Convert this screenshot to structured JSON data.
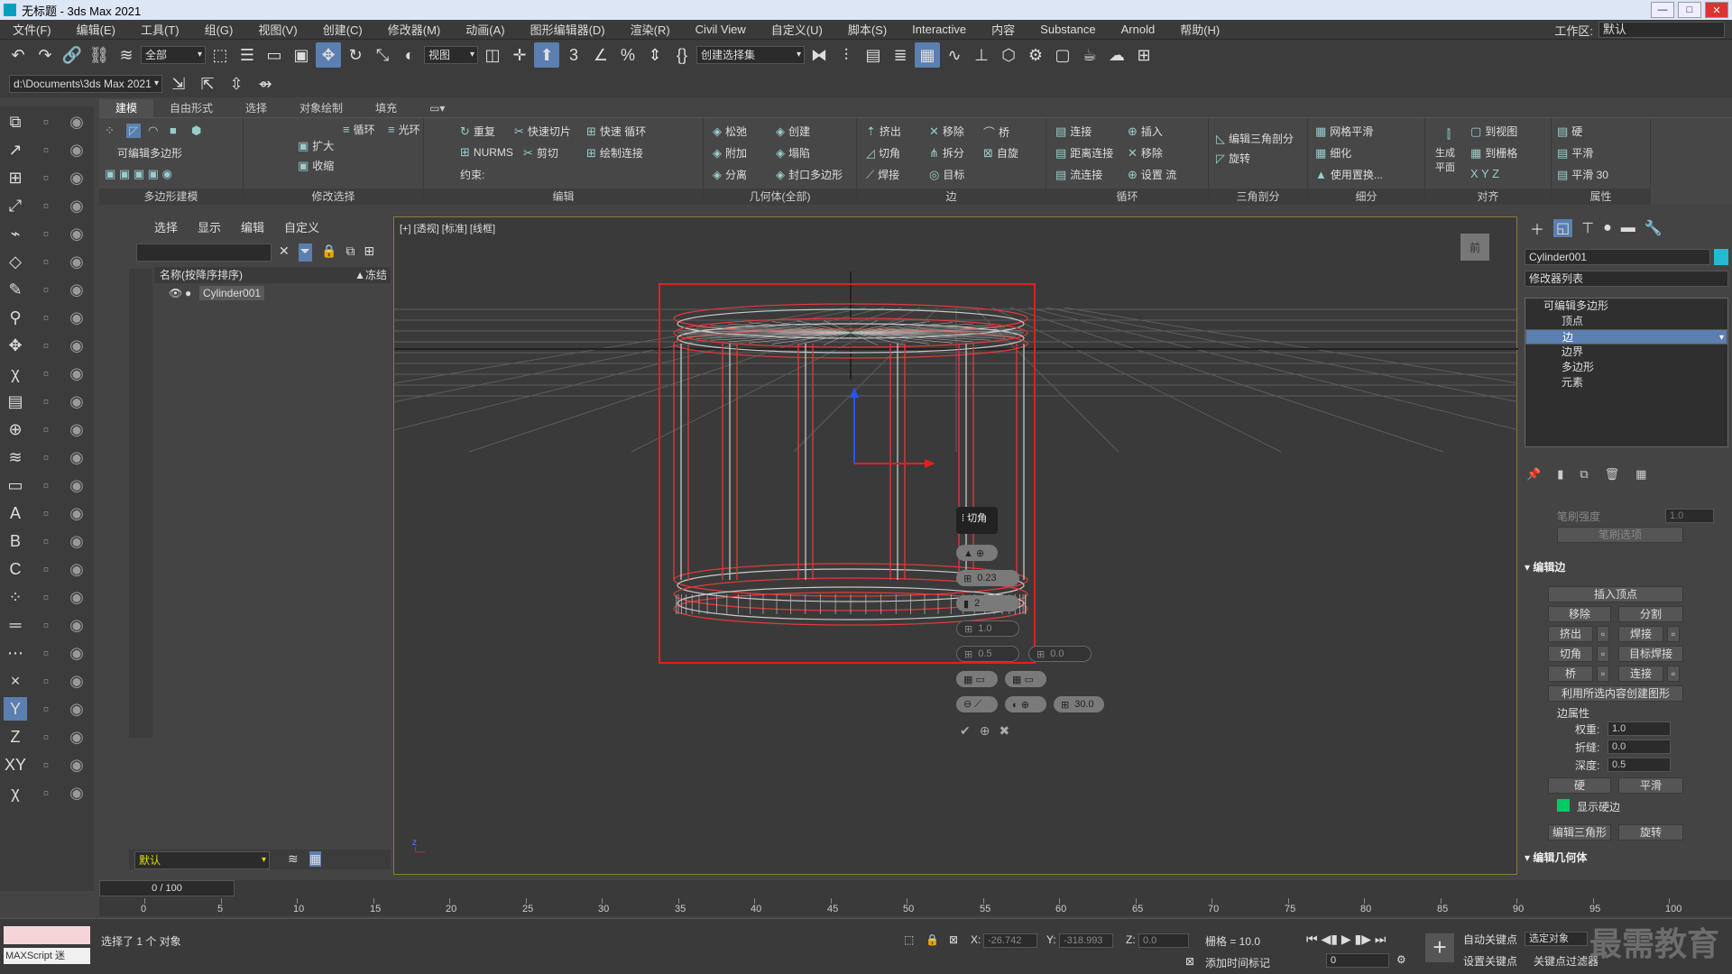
{
  "title": "无标题 - 3ds Max 2021",
  "menu": [
    "文件(F)",
    "编辑(E)",
    "工具(T)",
    "组(G)",
    "视图(V)",
    "创建(C)",
    "修改器(M)",
    "动画(A)",
    "图形编辑器(D)",
    "渲染(R)",
    "Civil View",
    "自定义(U)",
    "脚本(S)",
    "Interactive",
    "内容",
    "Substance",
    "Arnold",
    "帮助(H)"
  ],
  "workspace": {
    "label": "工作区:",
    "value": "默认"
  },
  "toolbar": {
    "filter": "全部",
    "refcoord": "视图",
    "selset": "创建选择集",
    "path": "d:\\Documents\\3ds Max 2021"
  },
  "ribbon": {
    "tabs": [
      "建模",
      "自由形式",
      "选择",
      "对象绘制",
      "填充"
    ],
    "groups": {
      "polymodel": "多边形建模",
      "modsel": "修改选择",
      "edit": "编辑",
      "geom": "几何体(全部)",
      "edge": "边",
      "loop": "循环",
      "tri": "三角剖分",
      "subdiv": "细分",
      "align": "对齐",
      "props": "属性"
    },
    "labels": {
      "editpoly": "可编辑多边形",
      "grow": "扩大",
      "shrink": "收缩",
      "loopbtn": "循环",
      "ring": "光环",
      "repeat": "重复",
      "quickslice": "快速切片",
      "quickloop": "快速 循环",
      "nurms": "NURMS",
      "cut": "剪切",
      "paintconn": "绘制连接",
      "constrain": "约束:",
      "relax": "松弛",
      "create": "创建",
      "attach": "附加",
      "collapse": "塌陷",
      "detach": "分离",
      "cap": "封口多边形",
      "extrude": "挤出",
      "remove": "移除",
      "bridge": "桥",
      "chamfer": "切角",
      "split": "拆分",
      "weld": "自旋",
      "weld2": "焊接",
      "target": "目标",
      "connect": "连接",
      "insert": "插入",
      "distconn": "距离连接",
      "remove2": "移除",
      "flowconn": "流连接",
      "setflow": "设置 流",
      "edittri": "编辑三角剖分",
      "turn": "旋转",
      "meshsmooth": "网格平滑",
      "tess": "细化",
      "usedisp": "使用置换...",
      "makeplanar": "生成平面",
      "toview": "到视图",
      "togrid": "到栅格",
      "hard": "硬",
      "smooth": "平滑",
      "smooth30": "平滑 30"
    }
  },
  "scene": {
    "tabs": [
      "选择",
      "显示",
      "编辑",
      "自定义"
    ],
    "header": "名称(按降序排序)",
    "frozen": "▲冻结",
    "item": "Cylinder001",
    "layer": "默认"
  },
  "viewport": {
    "label": "[+] [透视] [标准] [线框]"
  },
  "caddy": {
    "title": "切角",
    "v1": "0.23",
    "v2": "2",
    "v3": "1.0",
    "v4": "0.5",
    "v5": "0.0",
    "v6": "30.0"
  },
  "command": {
    "objname": "Cylinder001",
    "modlist": "修改器列表",
    "stack": [
      "可编辑多边形",
      "顶点",
      "边",
      "边界",
      "多边形",
      "元素"
    ],
    "selected_index": 2,
    "softsel": [
      "笔刷强度",
      "1.0",
      "笔刷选项"
    ],
    "editedges": {
      "title": "编辑边",
      "insertvert": "插入顶点",
      "remove": "移除",
      "split": "分割",
      "extrude": "挤出",
      "weld": "焊接",
      "chamfer": "切角",
      "targetweld": "目标焊接",
      "bridge": "桥",
      "connect": "连接",
      "createshape": "利用所选内容创建图形",
      "edgeprops": "边属性",
      "weight": "权重:",
      "weightv": "1.0",
      "crease": "折缝:",
      "creasev": "0.0",
      "depth": "深度:",
      "depthv": "0.5",
      "hard": "硬",
      "smooth": "平滑",
      "showhard": "显示硬边",
      "edittri": "编辑三角形",
      "turn": "旋转",
      "editgeo": "编辑几何体"
    }
  },
  "time": {
    "slider": "0 / 100",
    "ticks": [
      "0",
      "5",
      "10",
      "15",
      "20",
      "25",
      "30",
      "35",
      "40",
      "45",
      "50",
      "55",
      "60",
      "65",
      "70",
      "75",
      "80",
      "85",
      "90",
      "95",
      "100"
    ]
  },
  "status": {
    "selected": "选择了 1 个 对象",
    "x_label": "X:",
    "x": "-26.742",
    "y_label": "Y:",
    "y": "-318.993",
    "z_label": "Z:",
    "z": "0.0",
    "grid": "栅格 = 10.0",
    "addtime": "添加时间标记",
    "autokey": "自动关键点",
    "setkey": "设置关键点",
    "selobj": "选定对象",
    "keyfilter": "关键点过滤器",
    "frame": "0",
    "maxscript": "MAXScript 迷"
  },
  "watermark": "最需教育",
  "colors": {
    "accent": "#5a7fb0",
    "bbox": "#e02020",
    "wire": "#c8c8c8",
    "hardedge": "#00cc66"
  }
}
